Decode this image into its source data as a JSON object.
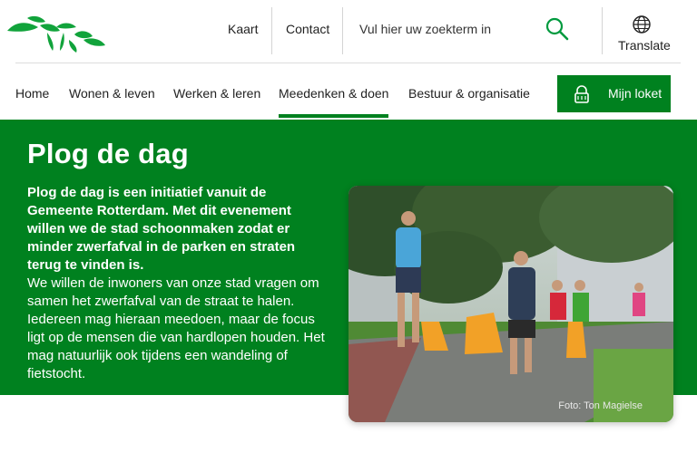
{
  "header": {
    "logo_alt": "Gemeente Rotterdam",
    "links": [
      "Kaart",
      "Contact"
    ],
    "search_placeholder": "Vul hier uw zoekterm in",
    "translate_label": "Translate"
  },
  "nav": {
    "items": [
      "Home",
      "Wonen & leven",
      "Werken & leren",
      "Meedenken & doen",
      "Bestuur & organisatie"
    ],
    "active_index": 3,
    "loket_label": "Mijn loket"
  },
  "hero": {
    "title": "Plog de dag",
    "lead": "Plog de dag is een initiatief vanuit de Gemeente Rotterdam. Met dit evenement willen we de stad schoonmaken zodat er minder zwerfafval in de parken en straten terug te vinden is.",
    "body": "We willen de inwoners van onze stad vragen om samen het zwerfafval van de straat te halen. Iedereen mag hieraan meedoen, maar de focus ligt op de mensen die van hardlopen houden. Het mag natuurlijk ook tijdens een wandeling of fietstocht.",
    "photo_credit": "Foto: Ton Magielse"
  },
  "colors": {
    "brand_green": "#00811f",
    "icon_green": "#009a3e",
    "text": "#222222"
  },
  "icons": [
    "rotterdam-logo",
    "search-icon",
    "globe-icon",
    "lock-icon"
  ]
}
